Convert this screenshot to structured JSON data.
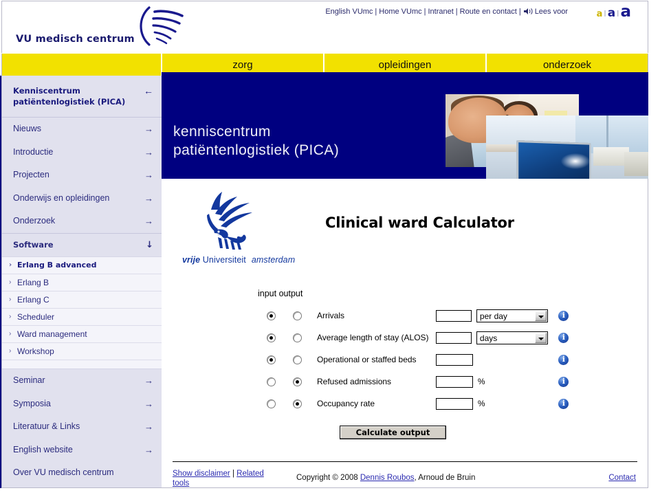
{
  "topbar": {
    "wordmark": "VU medisch centrum",
    "logo_icon": "vumc-swoosh-icon",
    "links": [
      {
        "label": "English VUmc"
      },
      {
        "label": "Home VUmc"
      },
      {
        "label": "Intranet"
      },
      {
        "label": "Route en contact"
      },
      {
        "label": "Lees voor",
        "icon": "speaker-icon"
      }
    ],
    "separator": "|",
    "font_sizer": {
      "small": "a",
      "medium": "a",
      "large": "a",
      "divider": "|"
    }
  },
  "nav": {
    "tabs": [
      {
        "label": "zorg"
      },
      {
        "label": "opleidingen"
      },
      {
        "label": "onderzoek"
      }
    ]
  },
  "sidebar": {
    "header": {
      "line1": "Kenniscentrum",
      "line2": "patiëntenlogistiek (PICA)",
      "arrow": "←"
    },
    "items": [
      {
        "label": "Nieuws",
        "arrow": "→"
      },
      {
        "label": "Introductie",
        "arrow": "→"
      },
      {
        "label": "Projecten",
        "arrow": "→"
      },
      {
        "label": "Onderwijs en opleidingen",
        "arrow": "→"
      },
      {
        "label": "Onderzoek",
        "arrow": "→"
      }
    ],
    "software": {
      "label": "Software",
      "arrow": "↓"
    },
    "software_items": [
      {
        "label": "Erlang B advanced",
        "active": true
      },
      {
        "label": "Erlang B",
        "active": false
      },
      {
        "label": "Erlang C",
        "active": false
      },
      {
        "label": "Scheduler",
        "active": false
      },
      {
        "label": "Ward management",
        "active": false
      },
      {
        "label": "Workshop",
        "active": false
      }
    ],
    "lower_items": [
      {
        "label": "Seminar",
        "arrow": "→"
      },
      {
        "label": "Symposia",
        "arrow": "→"
      },
      {
        "label": "Literatuur & Links",
        "arrow": "→"
      },
      {
        "label": "English website",
        "arrow": "→"
      },
      {
        "label": "Over VU medisch centrum",
        "arrow": ""
      }
    ]
  },
  "banner": {
    "line1": "kenniscentrum",
    "line2": "patiëntenlogistiek (PICA)",
    "photo1": "two-colleagues-photo",
    "photo2": "laptop-in-lab-photo"
  },
  "content": {
    "vu_logo": {
      "icon": "vu-griffin-icon",
      "vrije": "vrije",
      "universiteit": "Universiteit",
      "amsterdam": "amsterdam"
    },
    "page_title": "Clinical ward Calculator",
    "io_header": "input output",
    "rows": [
      {
        "label": "Arrivals",
        "input_selected": true,
        "output_selected": false,
        "value": "",
        "unit": "per day",
        "has_select": true,
        "suffix": "",
        "info": "info-icon"
      },
      {
        "label": "Average length of stay (ALOS)",
        "input_selected": true,
        "output_selected": false,
        "value": "",
        "unit": "days",
        "has_select": true,
        "suffix": "",
        "info": "info-icon"
      },
      {
        "label": "Operational or staffed beds",
        "input_selected": true,
        "output_selected": false,
        "value": "",
        "unit": "",
        "has_select": false,
        "suffix": "",
        "info": "info-icon"
      },
      {
        "label": "Refused admissions",
        "input_selected": false,
        "output_selected": true,
        "value": "",
        "unit": "",
        "has_select": false,
        "suffix": "%",
        "info": "info-icon"
      },
      {
        "label": "Occupancy rate",
        "input_selected": false,
        "output_selected": true,
        "value": "",
        "unit": "",
        "has_select": false,
        "suffix": "%",
        "info": "info-icon"
      }
    ],
    "calculate_button": "Calculate output"
  },
  "footer": {
    "show_disclaimer": "Show disclaimer",
    "separator": "|",
    "related_tools": "Related tools",
    "copyright_pre": "Copyright © 2008 ",
    "copyright_link": "Dennis Roubos",
    "copyright_post": ", Arnoud de Bruin",
    "contact": "Contact"
  },
  "colors": {
    "navy": "#000080",
    "yellow": "#f2e100",
    "sidebar_bg": "#e1e1ee",
    "link_blue": "#2b2bb0",
    "vu_blue": "#13389e"
  }
}
